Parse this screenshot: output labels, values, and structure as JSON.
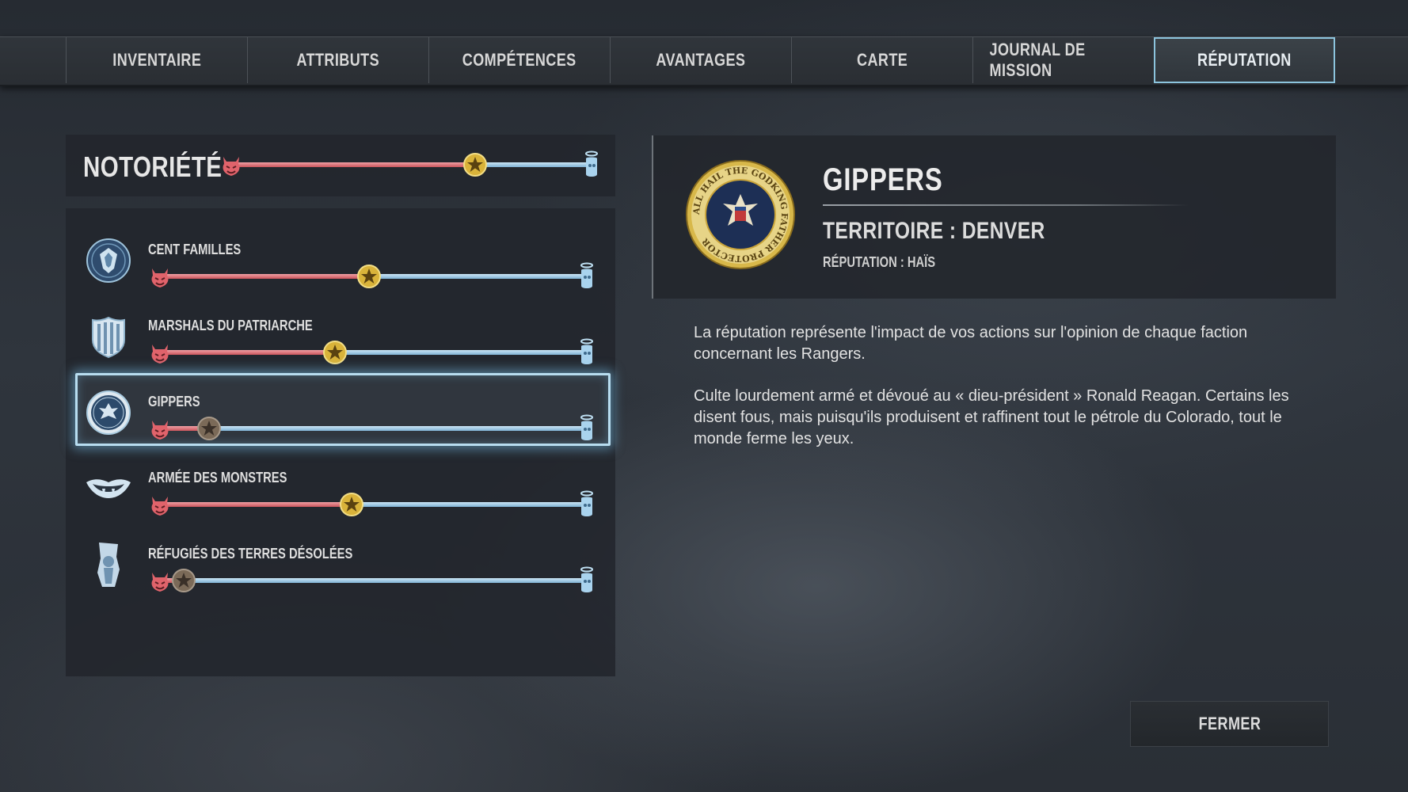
{
  "tabs": [
    {
      "label": "INVENTAIRE",
      "active": false
    },
    {
      "label": "ATTRIBUTS",
      "active": false
    },
    {
      "label": "COMPÉTENCES",
      "active": false
    },
    {
      "label": "AVANTAGES",
      "active": false
    },
    {
      "label": "CARTE",
      "active": false
    },
    {
      "label": "JOURNAL DE MISSION",
      "active": false
    },
    {
      "label": "RÉPUTATION",
      "active": true
    }
  ],
  "notoriety": {
    "title": "NOTORIÉTÉ",
    "level": 0.68,
    "marker": "gold-star"
  },
  "factions": [
    {
      "name": "CENT FAMILLES",
      "icon": "cent-familles-emblem-icon",
      "level": 0.49,
      "marker": "gold-star",
      "selected": false
    },
    {
      "name": "MARSHALS DU PATRIARCHE",
      "icon": "marshals-badge-icon",
      "level": 0.41,
      "marker": "gold-star",
      "selected": false
    },
    {
      "name": "GIPPERS",
      "icon": "gippers-seal-icon",
      "level": 0.11,
      "marker": "bronze-star",
      "selected": true
    },
    {
      "name": "ARMÉE DES MONSTRES",
      "icon": "monster-lips-icon",
      "level": 0.45,
      "marker": "gold-star",
      "selected": false
    },
    {
      "name": "RÉFUGIÉS DES TERRES DÉSOLÉES",
      "icon": "refugees-emblem-icon",
      "level": 0.05,
      "marker": "bronze-star",
      "selected": false
    }
  ],
  "detail": {
    "title": "GIPPERS",
    "territory": "TERRITOIRE : DENVER",
    "reputation": "RÉPUTATION : HAÏS",
    "seal_text": "ALL HAIL THE GODKING FATHER PROTECTOR",
    "description": [
      "La réputation représente l'impact de vos actions sur l'opinion de chaque faction concernant les Rangers.",
      "Culte lourdement armé et dévoué au « dieu-président » Ronald Reagan. Certains les disent fous, mais puisqu'ils produisent et raffinent tout le pétrole du Colorado, tout le monde ferme les yeux."
    ]
  },
  "close_label": "FERMER",
  "colors": {
    "hostile_red": "#d9646b",
    "friendly_blue": "#a9d3ee",
    "selection_glow": "#8cc4dd",
    "gold": "#d9b33a"
  }
}
